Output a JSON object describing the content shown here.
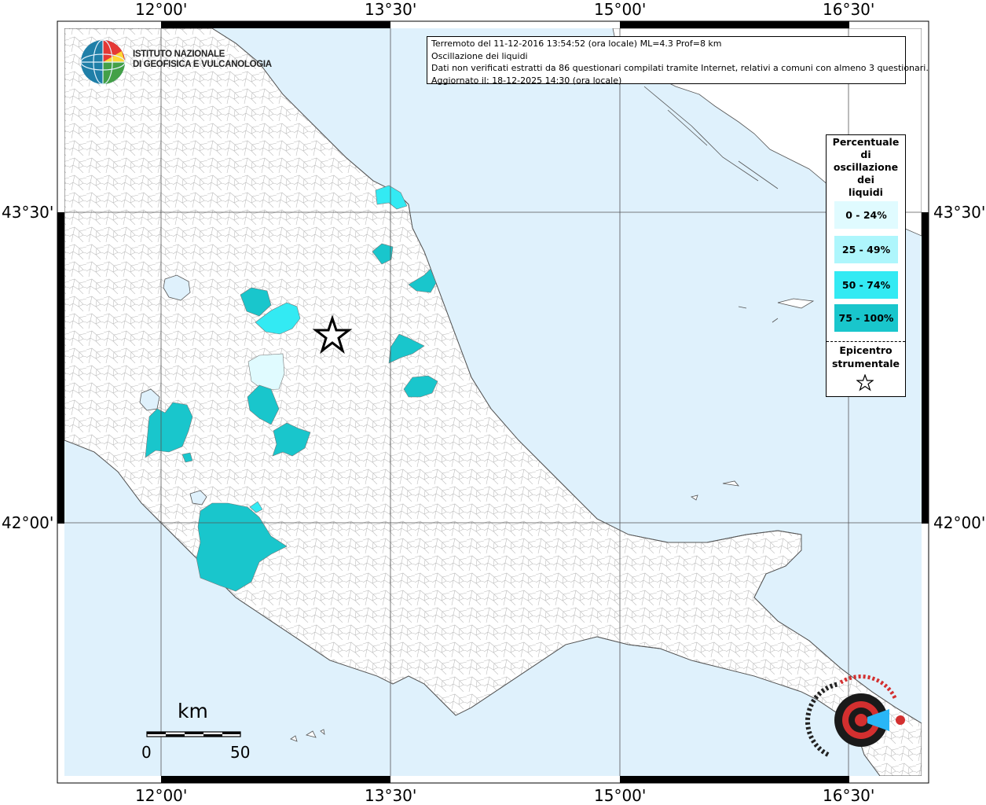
{
  "map": {
    "info_lines": [
      "Terremoto del 11-12-2016 13:54:52 (ora locale) ML=4.3 Prof=8 km",
      "Oscillazione dei liquidi",
      "Dati non verificati estratti da 86 questionari compilati tramite Internet, relativi a comuni con almeno 3 questionari.",
      "Aggiornato il: 18-12-2025 14:30 (ora locale)"
    ],
    "lon_labels": [
      "12°00'",
      "13°30'",
      "15°00'",
      "16°30'"
    ],
    "lat_labels": [
      "43°30'",
      "42°00'"
    ],
    "legend": {
      "title": [
        "Percentuale",
        "di",
        "oscillazione",
        "dei",
        "liquidi"
      ],
      "items": [
        {
          "label": "0 - 24%",
          "color": "#e0fbff"
        },
        {
          "label": "25 - 49%",
          "color": "#aef6fc"
        },
        {
          "label": "50 - 74%",
          "color": "#33eaf3"
        },
        {
          "label": "75 - 100%",
          "color": "#19c6cc"
        }
      ],
      "epicenter_label": [
        "Epicentro",
        "strumentale"
      ]
    },
    "scale_bar": {
      "unit": "km",
      "min_label": "0",
      "max_label": "50"
    },
    "logo_text": [
      "ISTITUTO NAZIONALE",
      "DI GEOFISICA E VULCANOLOGIA"
    ],
    "badge_text": {
      "ring": "haisentitoilterremoto.it",
      "www": "www"
    },
    "colors": {
      "sea": "#dff1fc",
      "land": "#ffffff",
      "border": "#8c8c8c",
      "class_0_24": "#e0fbff",
      "class_25_49": "#aef6fc",
      "class_50_74": "#33eaf3",
      "class_75_100": "#19c6cc"
    }
  }
}
